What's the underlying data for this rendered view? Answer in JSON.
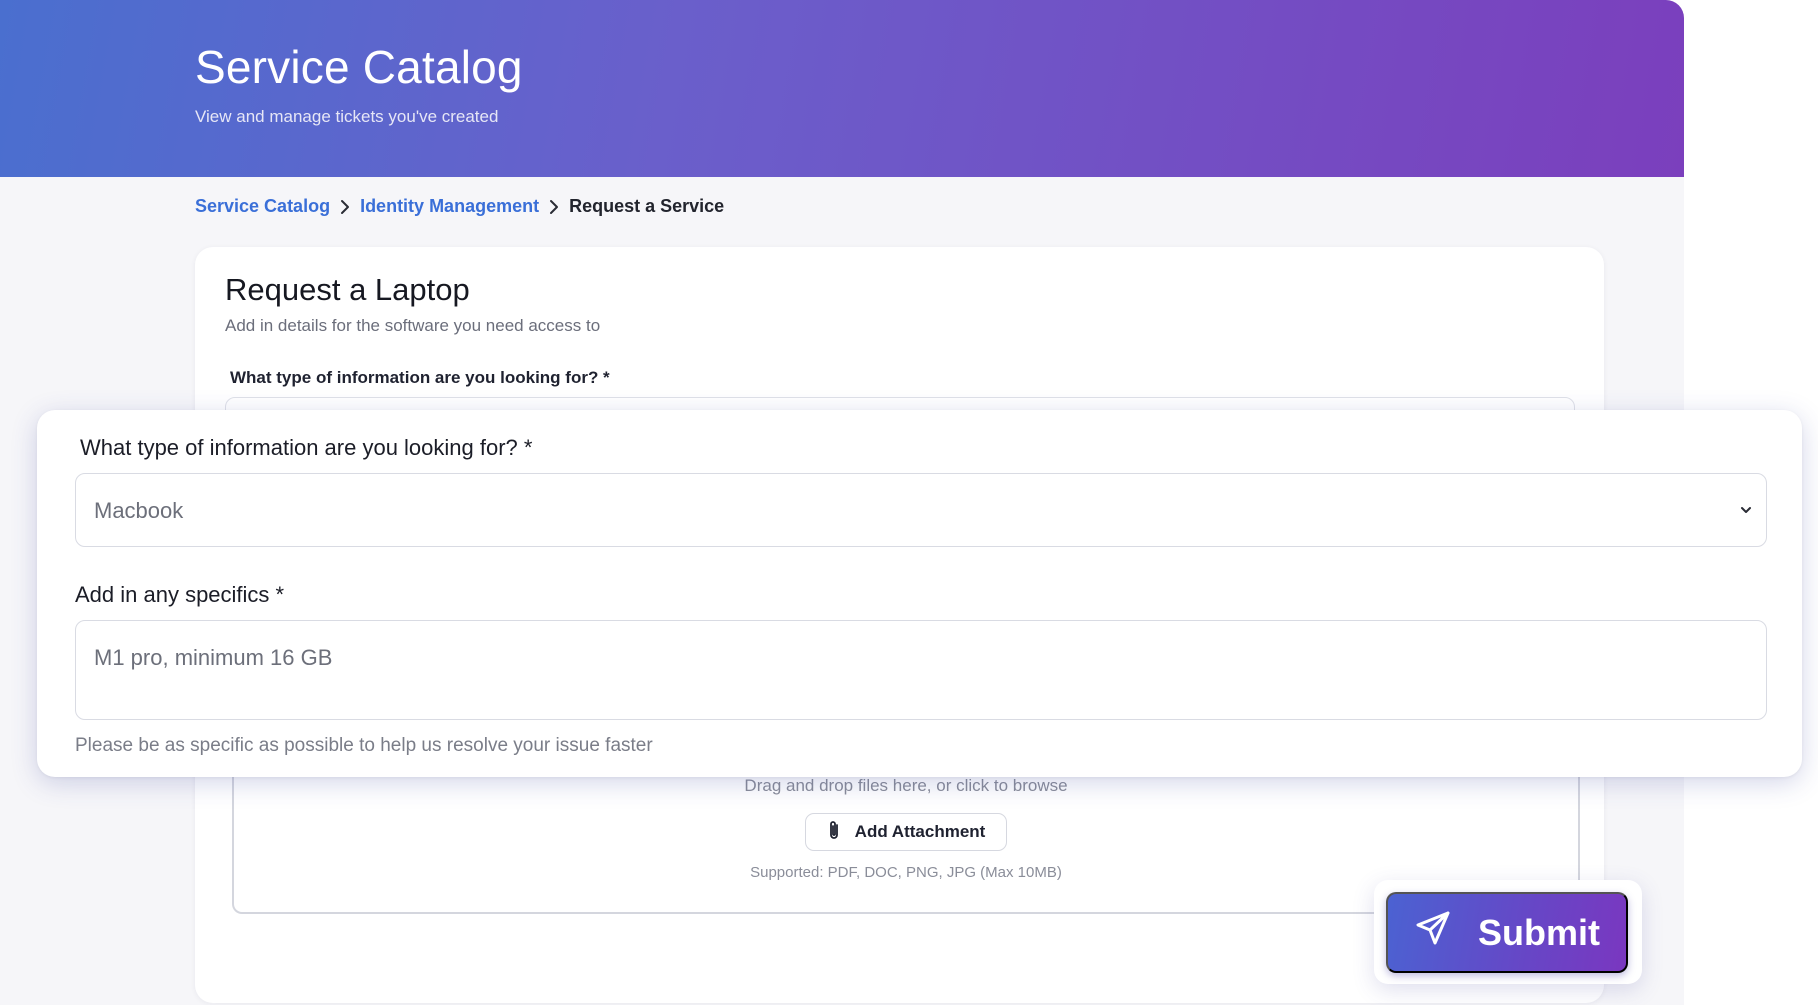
{
  "header": {
    "title": "Service Catalog",
    "subtitle": "View and manage tickets you've created"
  },
  "breadcrumb": [
    {
      "label": "Service Catalog"
    },
    {
      "label": "Identity Management"
    },
    {
      "label": "Request a Service"
    }
  ],
  "card": {
    "title": "Request a Laptop",
    "subtitle": "Add in details for the software you need access to",
    "question_label": "What type of information are you looking for? *"
  },
  "form": {
    "type_label": "What type of information are you looking for? *",
    "type_value": "Macbook",
    "specifics_label": "Add in any specifics *",
    "specifics_value": "M1 pro, minimum 16 GB",
    "help_text": "Please be as specific as possible to help us resolve your issue faster"
  },
  "attachments": {
    "drop_text": "Drag and drop files here, or click to browse",
    "button_label": "Add Attachment",
    "supported_text": "Supported: PDF, DOC, PNG, JPG (Max 10MB)"
  },
  "actions": {
    "submit_label": "Submit"
  },
  "colors": {
    "accent_link": "#3a6fd8",
    "brand_gradient_start": "#4a6fcf",
    "brand_gradient_end": "#7b3fbd"
  }
}
